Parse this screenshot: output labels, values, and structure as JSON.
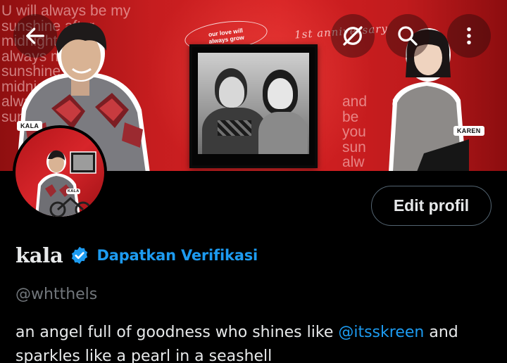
{
  "header": {
    "back_icon": "arrow-left-icon",
    "share_icon": "circle-slash-icon",
    "search_icon": "search-icon",
    "more_icon": "more-vertical-icon"
  },
  "banner": {
    "left_text": "U will always be my\nsunshine after\nmidnight U will\nalways my\nsunshine after\nmidnight will\nalways my\nsunshine\n              y\n              y\n              y",
    "right_text": "and      always\nbe            and\nyou          my\nsun          will\nalw          set",
    "script_caption": "1st anniversary",
    "pill_caption": "our love will always grow",
    "tag_left": "KALA",
    "tag_right": "KAREN",
    "colors": {
      "primary": "#c61d1f",
      "dark": "#8f0f10"
    }
  },
  "avatar": {
    "tag": "KALA"
  },
  "profile": {
    "edit_button_label": "Edit profil",
    "display_name": "kala",
    "verify_label": "Dapatkan Verifikasi",
    "handle": "@whtthels",
    "bio_before": "an angel full of goodness who shines like ",
    "bio_mention": "@itsskreen",
    "bio_after": " and sparkles like a pearl in a seashell"
  },
  "colors": {
    "accent": "#1d9bf0",
    "background": "#000000",
    "text": "#e7e9ea",
    "muted": "#71767b",
    "border": "#536471"
  }
}
